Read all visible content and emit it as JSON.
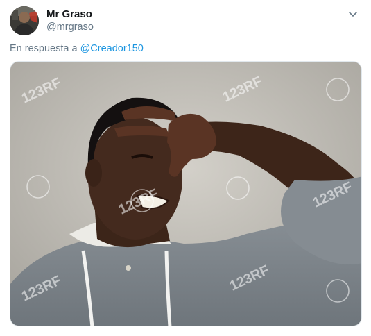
{
  "tweet": {
    "author_name": "Mr Graso",
    "author_handle": "@mrgraso",
    "reply_prefix": "En respuesta a ",
    "reply_mention": "@Creador150",
    "options_icon": "chevron-down-icon",
    "media": {
      "description_icon": "photo",
      "watermark_text": "123RF"
    }
  },
  "colors": {
    "name": "#14171a",
    "secondary": "#657786",
    "link": "#1b95e0",
    "border": "#e1e8ed"
  }
}
